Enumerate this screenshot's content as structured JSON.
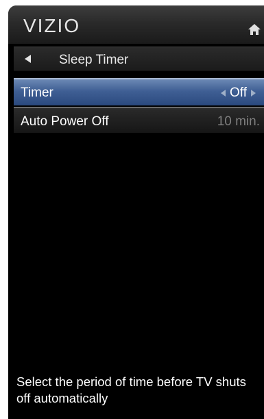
{
  "header": {
    "logo": "VIZIO",
    "home_icon": "home-icon"
  },
  "titlebar": {
    "back_icon": "left-arrow-icon",
    "title": "Sleep Timer"
  },
  "menu": [
    {
      "label": "Timer",
      "value": "Off",
      "selected": true,
      "left_arrow_icon": "left-arrow-icon",
      "right_arrow_icon": "right-arrow-icon"
    },
    {
      "label": "Auto Power Off",
      "value": "10 min.",
      "selected": false
    }
  ],
  "help": {
    "text": "Select the period of time before TV shuts off automatically"
  },
  "colors": {
    "selection_blue": "#3f5f94",
    "background": "#000000",
    "text": "#ffffff",
    "muted_value": "#7f7f7f"
  }
}
